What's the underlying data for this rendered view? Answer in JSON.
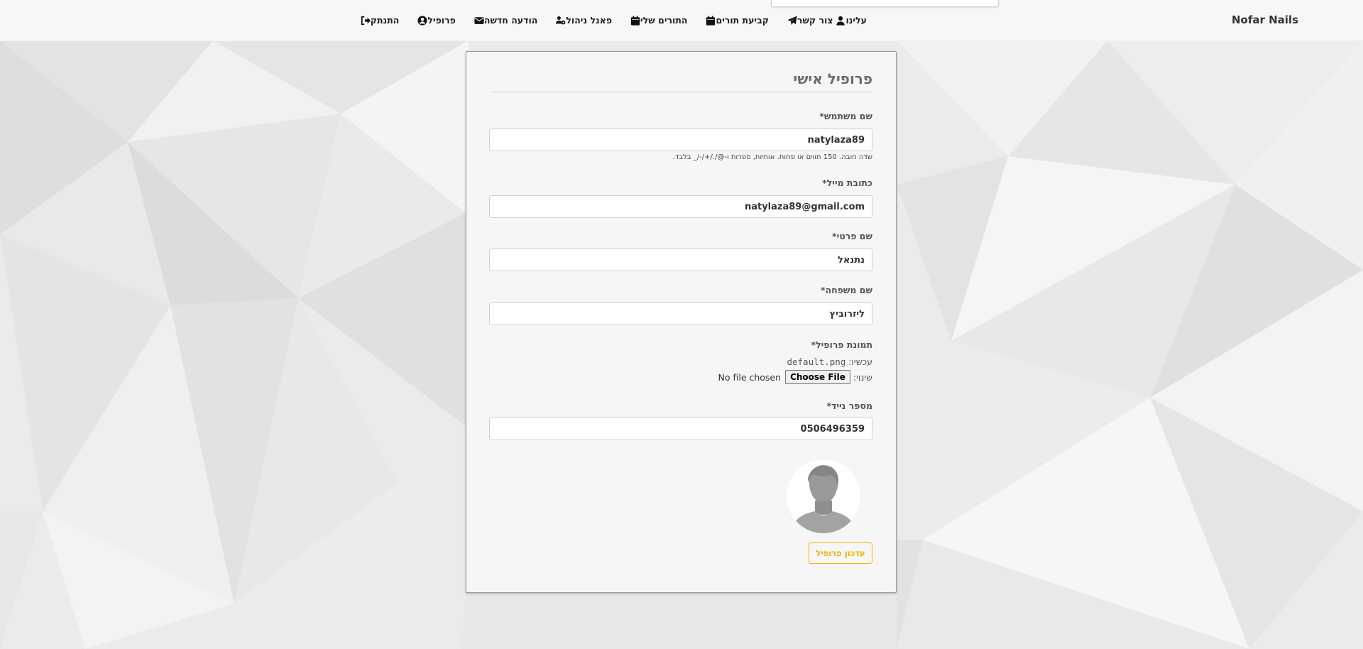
{
  "brand": "Nofar Nails",
  "nav": [
    {
      "label": "עלינו",
      "icon": "user-icon"
    },
    {
      "label": "צור קשר",
      "icon": "paper-plane-icon"
    },
    {
      "label": "קביעת תורים",
      "icon": "calendar-icon"
    },
    {
      "label": "התורים שלי",
      "icon": "calendar-icon"
    },
    {
      "label": "פאנל ניהול",
      "icon": "users-gear-icon"
    },
    {
      "label": "הודעה חדשה",
      "icon": "envelope-icon"
    },
    {
      "label": "פרופיל",
      "icon": "user-circle-icon"
    },
    {
      "label": "התנתק",
      "icon": "sign-out-icon"
    }
  ],
  "form": {
    "title": "פרופיל אישי",
    "username": {
      "label": "שם משתמש*",
      "value": "natylaza89",
      "hint": "שדה חובה. 150 תווים או פחות. אותיות, ספרות ו-@/./+/-/_ בלבד."
    },
    "email": {
      "label": "כתובת מייל*",
      "value": "natylaza89@gmail.com"
    },
    "first_name": {
      "label": "שם פרטי*",
      "value": "נתנאל"
    },
    "last_name": {
      "label": "שם משפחה*",
      "value": "ליזרוביץ"
    },
    "picture": {
      "label": "תמונת פרופיל*",
      "current_label": "עכשיו:",
      "current_value": "default.png",
      "change_label": "שינוי:",
      "choose_button": "Choose File",
      "no_file": "No file chosen"
    },
    "phone": {
      "label": "מספר נייד*",
      "value": "0506496359"
    },
    "submit": "עדכון פרופיל"
  },
  "colors": {
    "accent": "#f0b400",
    "card": "#f6f6f6",
    "navbar": "#f7f7f7"
  }
}
